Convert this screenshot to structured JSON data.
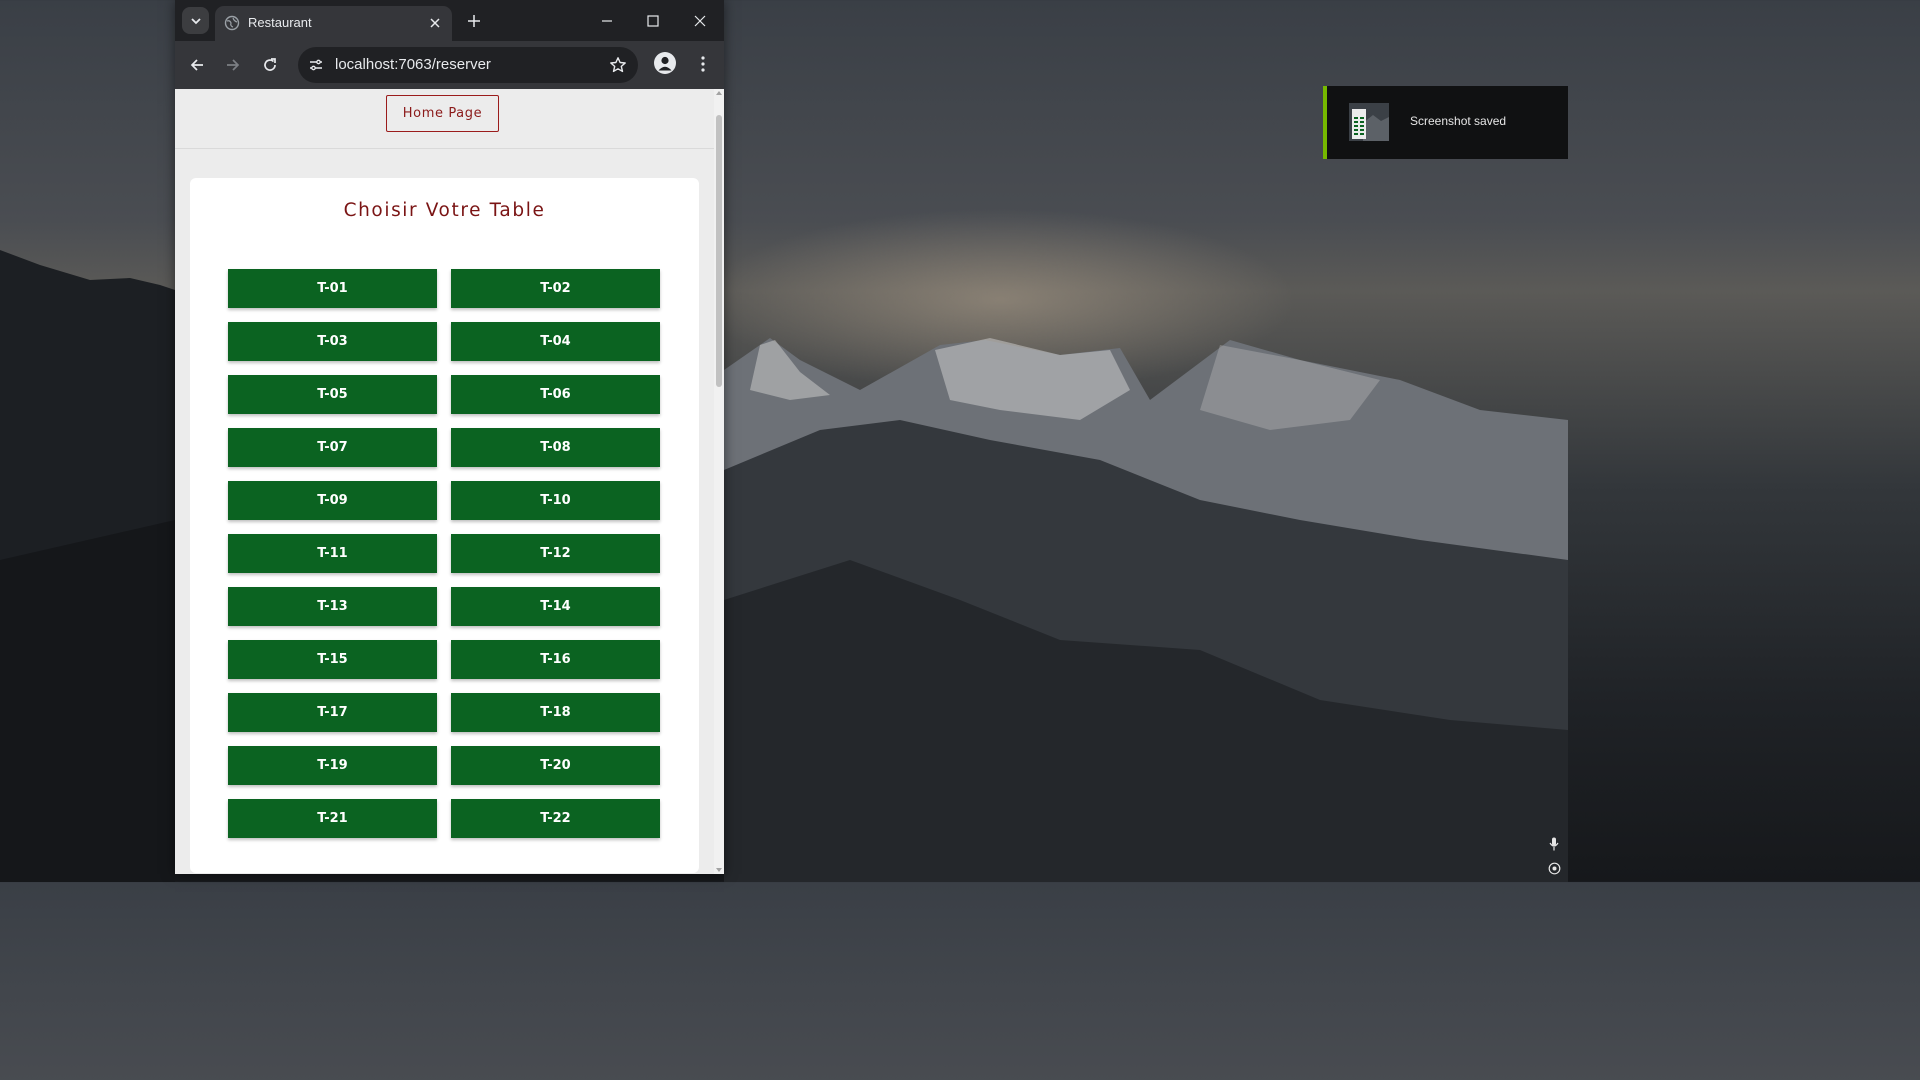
{
  "browser": {
    "tab": {
      "title": "Restaurant",
      "icon": "globe-icon"
    },
    "address_bar": {
      "url": "localhost:7063/reserver"
    },
    "icons": [
      "tab-search-icon",
      "close-icon",
      "plus-icon",
      "minimize-icon",
      "maximize-icon",
      "back-icon",
      "forward-icon",
      "reload-icon",
      "site-info-icon",
      "star-icon",
      "profile-icon",
      "more-vert-icon"
    ]
  },
  "page": {
    "home_button": "Home Page",
    "card_title": "Choisir Votre Table",
    "tables": [
      "T-01",
      "T-02",
      "T-03",
      "T-04",
      "T-05",
      "T-06",
      "T-07",
      "T-08",
      "T-09",
      "T-10",
      "T-11",
      "T-12",
      "T-13",
      "T-14",
      "T-15",
      "T-16",
      "T-17",
      "T-18",
      "T-19",
      "T-20",
      "T-21",
      "T-22"
    ]
  },
  "notification": {
    "text": "Screenshot saved",
    "accent_color": "#76b900"
  },
  "colors": {
    "table_button": "#0b6321",
    "title_red": "#7a1414",
    "home_border": "#9b1c1c"
  }
}
